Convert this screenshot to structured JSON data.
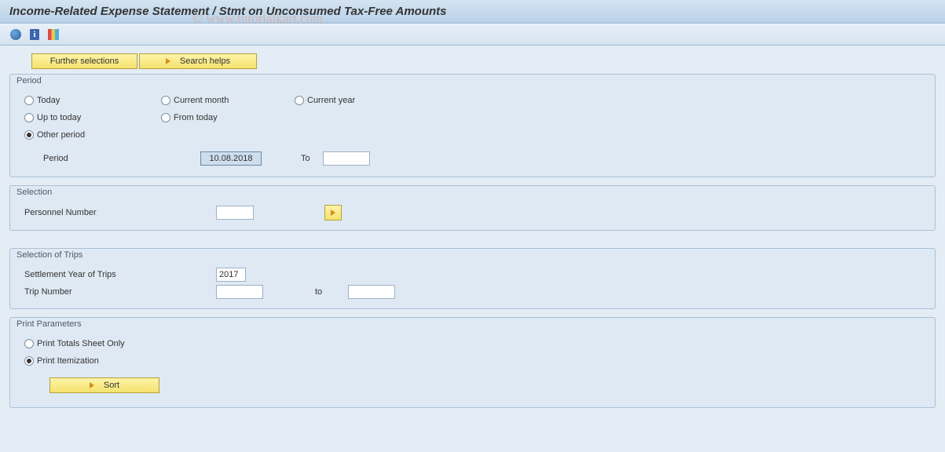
{
  "title": "Income-Related Expense Statement / Stmt on Unconsumed Tax-Free Amounts",
  "watermark": "© www.tutorialkart.com",
  "top_buttons": {
    "further_selections": "Further selections",
    "search_helps": "Search helps"
  },
  "period": {
    "legend": "Period",
    "options": {
      "today": "Today",
      "current_month": "Current month",
      "current_year": "Current year",
      "up_to_today": "Up to today",
      "from_today": "From today",
      "other_period": "Other period"
    },
    "selected": "other_period",
    "period_label": "Period",
    "period_from": "10.08.2018",
    "to_label": "To",
    "period_to": ""
  },
  "selection": {
    "legend": "Selection",
    "personnel_number_label": "Personnel Number",
    "personnel_number_value": ""
  },
  "trips": {
    "legend": "Selection of Trips",
    "settlement_year_label": "Settlement Year of Trips",
    "settlement_year_value": "2017",
    "trip_number_label": "Trip Number",
    "trip_number_from": "",
    "to_label": "to",
    "trip_number_to": ""
  },
  "print": {
    "legend": "Print Parameters",
    "totals_only": "Print Totals Sheet Only",
    "itemization": "Print Itemization",
    "selected": "itemization",
    "sort_label": "Sort"
  }
}
